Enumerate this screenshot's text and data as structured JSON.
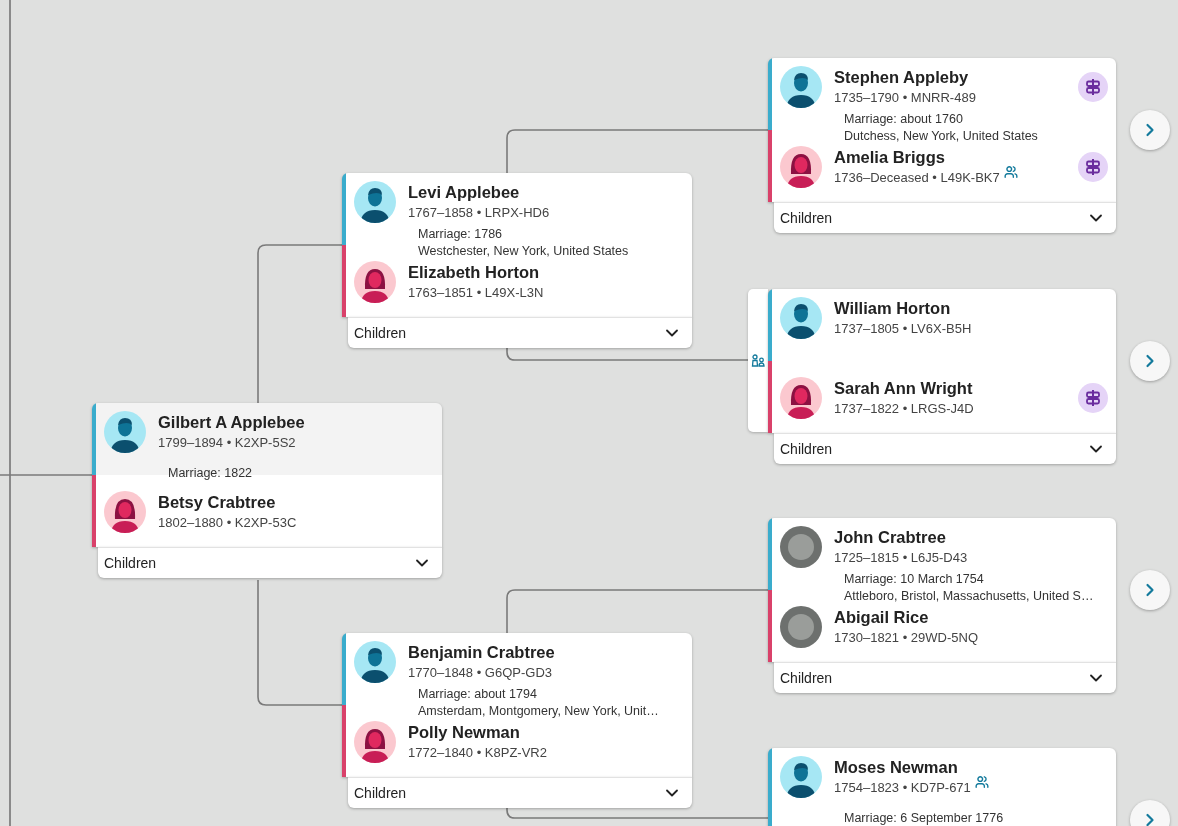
{
  "couples": [
    {
      "selected": true,
      "link_tab": false,
      "next_button": false,
      "husband": {
        "name": "Gilbert A Applebee",
        "details": "1799–1894 • K2XP-5S2",
        "kind": "silhouette",
        "research_hint": false,
        "relationship_icon": false
      },
      "marriage": [
        "Marriage: 1822"
      ],
      "wife": {
        "name": "Betsy Crabtree",
        "details": "1802–1880 • K2XP-53C",
        "kind": "silhouette",
        "research_hint": false,
        "relationship_icon": false
      },
      "children_label": "Children"
    },
    {
      "selected": false,
      "link_tab": false,
      "next_button": false,
      "husband": {
        "name": "Levi Applebee",
        "details": "1767–1858 • LRPX-HD6",
        "kind": "silhouette",
        "research_hint": false,
        "relationship_icon": false
      },
      "marriage": [
        "Marriage: 1786",
        "Westchester, New York, United States"
      ],
      "wife": {
        "name": "Elizabeth Horton",
        "details": "1763–1851 • L49X-L3N",
        "kind": "silhouette",
        "research_hint": false,
        "relationship_icon": false
      },
      "children_label": "Children"
    },
    {
      "selected": false,
      "link_tab": false,
      "next_button": false,
      "husband": {
        "name": "Benjamin Crabtree",
        "details": "1770–1848 • G6QP-GD3",
        "kind": "silhouette",
        "research_hint": false,
        "relationship_icon": false
      },
      "marriage": [
        "Marriage: about 1794",
        "Amsterdam, Montgomery, New York, Unit…"
      ],
      "wife": {
        "name": "Polly Newman",
        "details": "1772–1840 • K8PZ-VR2",
        "kind": "silhouette",
        "research_hint": false,
        "relationship_icon": false
      },
      "children_label": "Children"
    },
    {
      "selected": false,
      "link_tab": false,
      "next_button": true,
      "husband": {
        "name": "Stephen Appleby",
        "details": "1735–1790 • MNRR-489",
        "kind": "silhouette",
        "research_hint": true,
        "relationship_icon": false
      },
      "marriage": [
        "Marriage: about 1760",
        "Dutchess, New York, United States"
      ],
      "wife": {
        "name": "Amelia Briggs",
        "details": "1736–Deceased • L49K-BK7",
        "kind": "silhouette",
        "research_hint": true,
        "relationship_icon": true
      },
      "children_label": "Children"
    },
    {
      "selected": false,
      "link_tab": true,
      "next_button": true,
      "husband": {
        "name": "William Horton",
        "details": "1737–1805 • LV6X-B5H",
        "kind": "silhouette",
        "research_hint": false,
        "relationship_icon": false
      },
      "wife": {
        "name": "Sarah Ann Wright",
        "details": "1737–1822 • LRGS-J4D",
        "kind": "silhouette",
        "research_hint": true,
        "relationship_icon": false
      },
      "children_label": "Children"
    },
    {
      "selected": false,
      "link_tab": false,
      "next_button": true,
      "husband": {
        "name": "John Crabtree",
        "details": "1725–1815 • L6J5-D43",
        "kind": "photo",
        "research_hint": false,
        "relationship_icon": false
      },
      "marriage": [
        "Marriage: 10 March 1754",
        "Attleboro, Bristol, Massachusetts, United S…"
      ],
      "wife": {
        "name": "Abigail Rice",
        "details": "1730–1821 • 29WD-5NQ",
        "kind": "photo",
        "research_hint": false,
        "relationship_icon": false
      },
      "children_label": "Children"
    },
    {
      "selected": false,
      "link_tab": false,
      "next_button": true,
      "husband": {
        "name": "Moses Newman",
        "details": "1754–1823 • KD7P-671",
        "kind": "silhouette",
        "research_hint": false,
        "relationship_icon": true
      },
      "marriage": [
        "Marriage: 6 September 1776"
      ]
    }
  ]
}
